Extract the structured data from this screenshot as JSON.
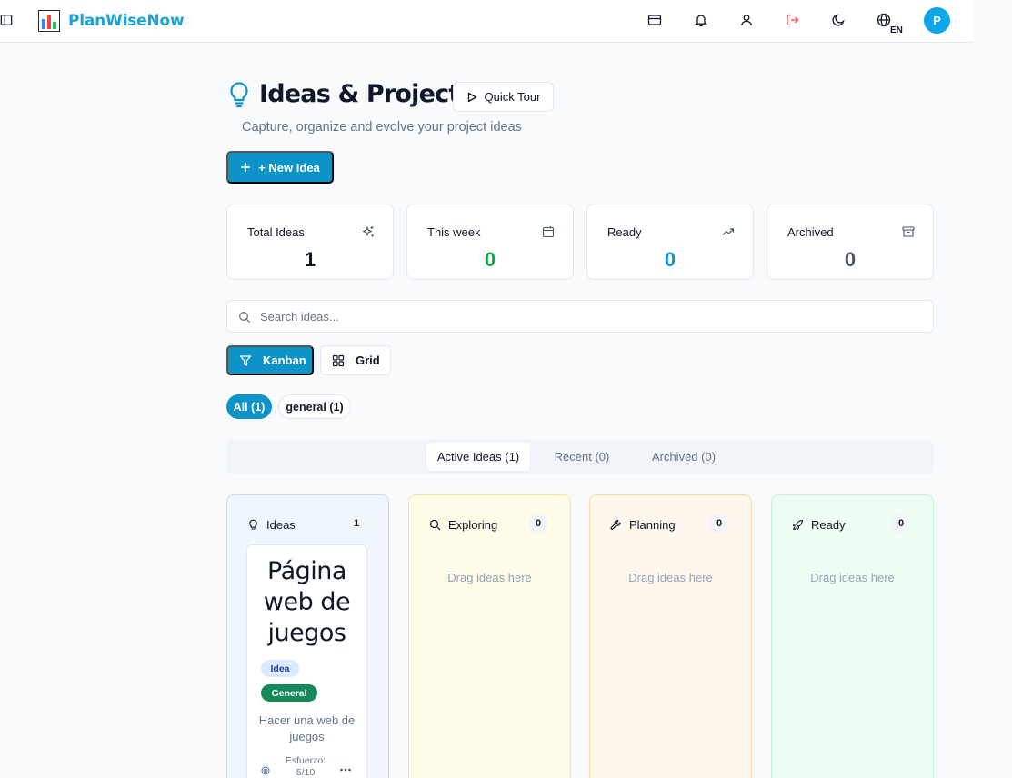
{
  "header": {
    "app_name": "PlanWiseNow",
    "lang_code": "EN",
    "avatar_initial": "P",
    "icons": [
      "sidebar-toggle-icon",
      "card-icon",
      "bell-icon",
      "user-icon",
      "logout-icon",
      "moon-icon",
      "globe-icon"
    ]
  },
  "page": {
    "title": "Ideas & Projects",
    "quick_tour_label": "Quick Tour",
    "subtitle": "Capture, organize and evolve your project ideas",
    "new_idea_label": "+ New Idea"
  },
  "stats": [
    {
      "label": "Total Ideas",
      "value": "1",
      "color": "#0f172a",
      "icon": "sparkles-icon"
    },
    {
      "label": "This week",
      "value": "0",
      "color": "#16a34a",
      "icon": "calendar-icon"
    },
    {
      "label": "Ready",
      "value": "0",
      "color": "#0e93c8",
      "icon": "trending-up-icon"
    },
    {
      "label": "Archived",
      "value": "0",
      "color": "#475569",
      "icon": "archive-icon"
    }
  ],
  "search": {
    "placeholder": "Search ideas..."
  },
  "views": {
    "kanban_label": "Kanban",
    "grid_label": "Grid",
    "active": "kanban"
  },
  "filters": [
    {
      "label": "All (1)",
      "active": true
    },
    {
      "label": "general (1)",
      "active": false
    }
  ],
  "tabs": [
    {
      "label": "Active Ideas (1)",
      "active": true
    },
    {
      "label": "Recent (0)",
      "active": false
    },
    {
      "label": "Archived (0)",
      "active": false
    }
  ],
  "columns": [
    {
      "title": "Ideas",
      "count": "1",
      "bg": "#eff6ff",
      "border": "#bfdbfe",
      "icon": "lightbulb-icon"
    },
    {
      "title": "Exploring",
      "count": "0",
      "bg": "#fefce8",
      "border": "#fde68a",
      "icon": "search-icon",
      "empty_text": "Drag ideas here"
    },
    {
      "title": "Planning",
      "count": "0",
      "bg": "#fff7ed",
      "border": "#fed7aa",
      "icon": "wrench-icon",
      "empty_text": "Drag ideas here"
    },
    {
      "title": "Ready",
      "count": "0",
      "bg": "#f0fdf4",
      "border": "#bbf7d0",
      "icon": "rocket-icon",
      "empty_text": "Drag ideas here"
    }
  ],
  "idea_card": {
    "title": "Página web de juegos",
    "type_badge": "Idea",
    "category_badge": "General",
    "description": "Hacer una web de juegos",
    "effort_label": "Esfuerzo:",
    "effort_value": "5/10"
  },
  "colors": {
    "brand": "#1aa3d6",
    "primary": "#0e93c8",
    "background": "#f8fafc"
  }
}
